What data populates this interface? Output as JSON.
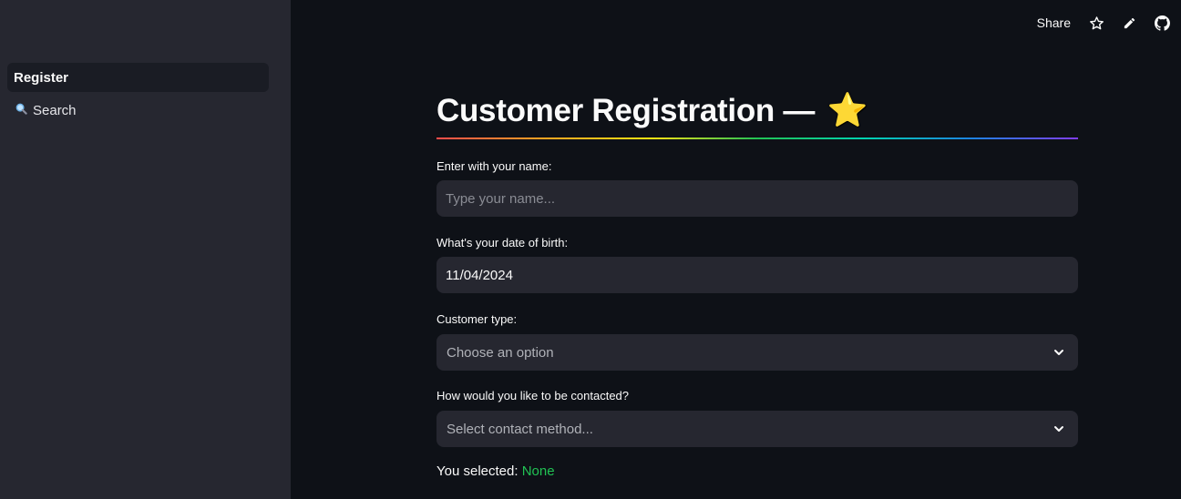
{
  "sidebar": {
    "items": [
      {
        "label": "Register",
        "active": true,
        "icon": ""
      },
      {
        "label": "Search",
        "active": false,
        "icon": "magnifier-icon"
      }
    ]
  },
  "header": {
    "share_label": "Share",
    "icons": [
      "star-icon",
      "pencil-icon",
      "github-icon"
    ]
  },
  "main": {
    "title": "Customer Registration —",
    "title_emoji": "⭐",
    "name": {
      "label": "Enter with your name:",
      "placeholder": "Type your name...",
      "value": ""
    },
    "dob": {
      "label": "What's your date of birth:",
      "value": "11/04/2024"
    },
    "customer_type": {
      "label": "Customer type:",
      "placeholder": "Choose an option"
    },
    "contact": {
      "label": "How would you like to be contacted?",
      "placeholder": "Select contact method..."
    },
    "result": {
      "prefix": "You selected:",
      "value": "None"
    }
  },
  "colors": {
    "background": "#0e1117",
    "sidebar": "#262730",
    "input": "#262730",
    "accent_green": "#21c354",
    "star": "#f7c437"
  }
}
